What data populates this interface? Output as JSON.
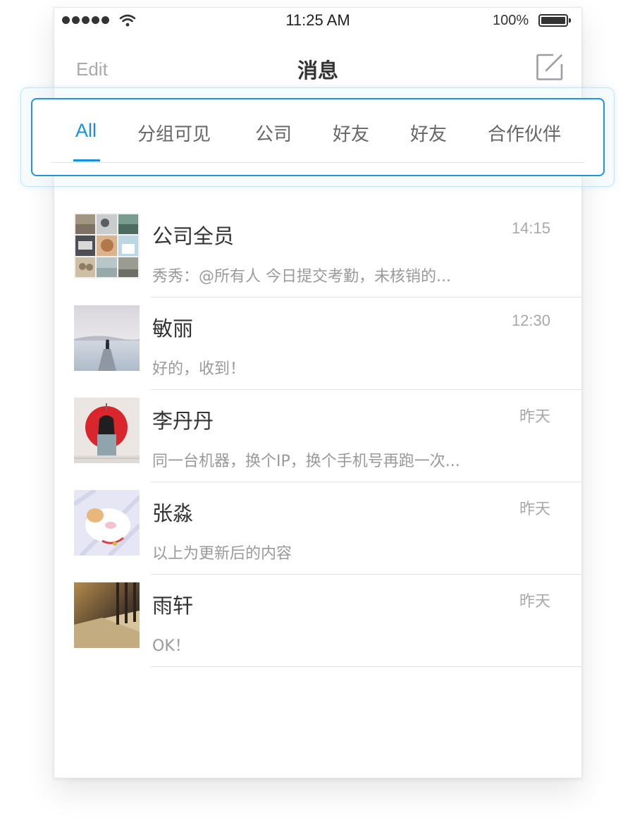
{
  "status_bar": {
    "time": "11:25 AM",
    "battery": "100%"
  },
  "nav": {
    "edit_label": "Edit",
    "title": "消息",
    "compose_icon": "compose-icon"
  },
  "tabs": [
    {
      "label": "All",
      "active": true
    },
    {
      "label": "分组可见",
      "active": false
    },
    {
      "label": "公司",
      "active": false
    },
    {
      "label": "好友",
      "active": false
    },
    {
      "label": "好友",
      "active": false
    },
    {
      "label": "合作伙伴",
      "active": false
    }
  ],
  "conversations": [
    {
      "name": "公司全员",
      "preview": "秀秀：@所有人  今日提交考勤，未核销的...",
      "time": "14:15",
      "avatar": "group-collage-avatar"
    },
    {
      "name": "敏丽",
      "preview": "好的，收到！",
      "time": "12:30",
      "avatar": "lake-pier-avatar"
    },
    {
      "name": "李丹丹",
      "preview": "同一台机器，换个IP，换个手机号再跑一次...",
      "time": "昨天",
      "avatar": "umbrella-girl-avatar"
    },
    {
      "name": "张淼",
      "preview": "以上为更新后的内容",
      "time": "昨天",
      "avatar": "cat-avatar"
    },
    {
      "name": "雨轩",
      "preview": "OK！",
      "time": "昨天",
      "avatar": "hallway-avatar"
    }
  ],
  "colors": {
    "accent": "#1890e0",
    "highlight_border": "#1e95dd"
  }
}
